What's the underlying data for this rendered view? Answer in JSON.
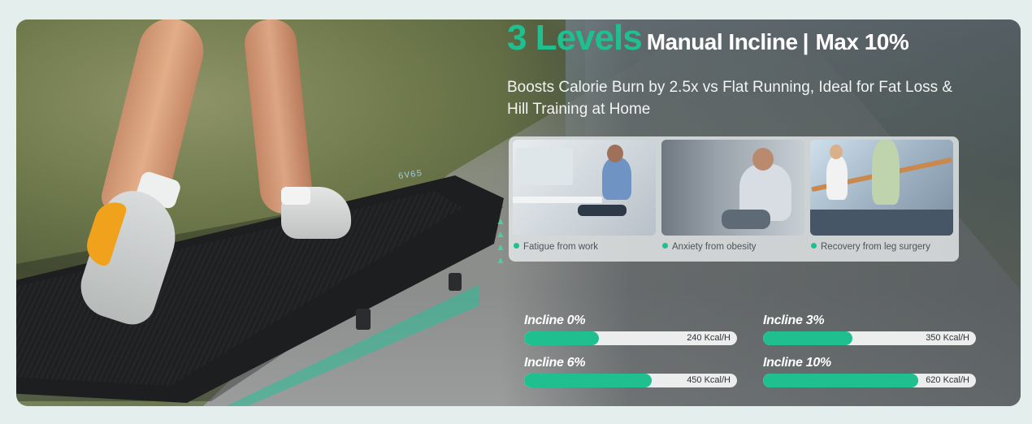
{
  "headline": {
    "levels": "3 Levels",
    "rest": "Manual Incline",
    "separator": "|",
    "max": "Max 10%"
  },
  "subtitle": "Boosts Calorie Burn by 2.5x vs Flat Running, Ideal for Fat Loss & Hill Training at Home",
  "treadmill_display": "6V65",
  "scenarios": [
    {
      "caption": "Fatigue from work"
    },
    {
      "caption": "Anxiety from obesity"
    },
    {
      "caption": "Recovery from leg surgery"
    }
  ],
  "inclines": [
    {
      "label": "Incline 0%",
      "kcal": "240 Kcal/H",
      "fill": 0.35
    },
    {
      "label": "Incline 3%",
      "kcal": "350 Kcal/H",
      "fill": 0.42
    },
    {
      "label": "Incline 6%",
      "kcal": "450 Kcal/H",
      "fill": 0.6
    },
    {
      "label": "Incline 10%",
      "kcal": "620 Kcal/H",
      "fill": 0.73
    }
  ],
  "colors": {
    "accent": "#1fbf8f",
    "track": "#eceeee"
  }
}
